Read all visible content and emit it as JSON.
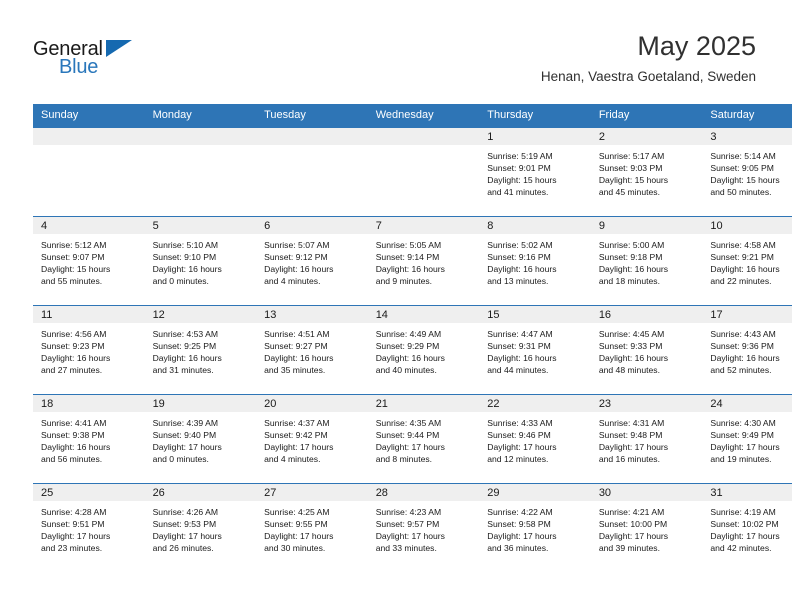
{
  "brand": {
    "name_part1": "General",
    "name_part2": "Blue",
    "flag_icon": "triangle-flag-icon",
    "accent_color": "#2e75b6",
    "dark_color": "#1a1a1a"
  },
  "header": {
    "title": "May 2025",
    "subtitle": "Henan, Vaestra Goetaland, Sweden"
  },
  "calendar": {
    "weekday_headers": [
      "Sunday",
      "Monday",
      "Tuesday",
      "Wednesday",
      "Thursday",
      "Friday",
      "Saturday"
    ],
    "weeks": [
      [
        {
          "day": "",
          "empty": true,
          "sunrise": "",
          "sunset": "",
          "daylight_line1": "",
          "daylight_line2": ""
        },
        {
          "day": "",
          "empty": true,
          "sunrise": "",
          "sunset": "",
          "daylight_line1": "",
          "daylight_line2": ""
        },
        {
          "day": "",
          "empty": true,
          "sunrise": "",
          "sunset": "",
          "daylight_line1": "",
          "daylight_line2": ""
        },
        {
          "day": "",
          "empty": true,
          "sunrise": "",
          "sunset": "",
          "daylight_line1": "",
          "daylight_line2": ""
        },
        {
          "day": "1",
          "empty": false,
          "sunrise": "Sunrise: 5:19 AM",
          "sunset": "Sunset: 9:01 PM",
          "daylight_line1": "Daylight: 15 hours",
          "daylight_line2": "and 41 minutes."
        },
        {
          "day": "2",
          "empty": false,
          "sunrise": "Sunrise: 5:17 AM",
          "sunset": "Sunset: 9:03 PM",
          "daylight_line1": "Daylight: 15 hours",
          "daylight_line2": "and 45 minutes."
        },
        {
          "day": "3",
          "empty": false,
          "sunrise": "Sunrise: 5:14 AM",
          "sunset": "Sunset: 9:05 PM",
          "daylight_line1": "Daylight: 15 hours",
          "daylight_line2": "and 50 minutes."
        }
      ],
      [
        {
          "day": "4",
          "empty": false,
          "sunrise": "Sunrise: 5:12 AM",
          "sunset": "Sunset: 9:07 PM",
          "daylight_line1": "Daylight: 15 hours",
          "daylight_line2": "and 55 minutes."
        },
        {
          "day": "5",
          "empty": false,
          "sunrise": "Sunrise: 5:10 AM",
          "sunset": "Sunset: 9:10 PM",
          "daylight_line1": "Daylight: 16 hours",
          "daylight_line2": "and 0 minutes."
        },
        {
          "day": "6",
          "empty": false,
          "sunrise": "Sunrise: 5:07 AM",
          "sunset": "Sunset: 9:12 PM",
          "daylight_line1": "Daylight: 16 hours",
          "daylight_line2": "and 4 minutes."
        },
        {
          "day": "7",
          "empty": false,
          "sunrise": "Sunrise: 5:05 AM",
          "sunset": "Sunset: 9:14 PM",
          "daylight_line1": "Daylight: 16 hours",
          "daylight_line2": "and 9 minutes."
        },
        {
          "day": "8",
          "empty": false,
          "sunrise": "Sunrise: 5:02 AM",
          "sunset": "Sunset: 9:16 PM",
          "daylight_line1": "Daylight: 16 hours",
          "daylight_line2": "and 13 minutes."
        },
        {
          "day": "9",
          "empty": false,
          "sunrise": "Sunrise: 5:00 AM",
          "sunset": "Sunset: 9:18 PM",
          "daylight_line1": "Daylight: 16 hours",
          "daylight_line2": "and 18 minutes."
        },
        {
          "day": "10",
          "empty": false,
          "sunrise": "Sunrise: 4:58 AM",
          "sunset": "Sunset: 9:21 PM",
          "daylight_line1": "Daylight: 16 hours",
          "daylight_line2": "and 22 minutes."
        }
      ],
      [
        {
          "day": "11",
          "empty": false,
          "sunrise": "Sunrise: 4:56 AM",
          "sunset": "Sunset: 9:23 PM",
          "daylight_line1": "Daylight: 16 hours",
          "daylight_line2": "and 27 minutes."
        },
        {
          "day": "12",
          "empty": false,
          "sunrise": "Sunrise: 4:53 AM",
          "sunset": "Sunset: 9:25 PM",
          "daylight_line1": "Daylight: 16 hours",
          "daylight_line2": "and 31 minutes."
        },
        {
          "day": "13",
          "empty": false,
          "sunrise": "Sunrise: 4:51 AM",
          "sunset": "Sunset: 9:27 PM",
          "daylight_line1": "Daylight: 16 hours",
          "daylight_line2": "and 35 minutes."
        },
        {
          "day": "14",
          "empty": false,
          "sunrise": "Sunrise: 4:49 AM",
          "sunset": "Sunset: 9:29 PM",
          "daylight_line1": "Daylight: 16 hours",
          "daylight_line2": "and 40 minutes."
        },
        {
          "day": "15",
          "empty": false,
          "sunrise": "Sunrise: 4:47 AM",
          "sunset": "Sunset: 9:31 PM",
          "daylight_line1": "Daylight: 16 hours",
          "daylight_line2": "and 44 minutes."
        },
        {
          "day": "16",
          "empty": false,
          "sunrise": "Sunrise: 4:45 AM",
          "sunset": "Sunset: 9:33 PM",
          "daylight_line1": "Daylight: 16 hours",
          "daylight_line2": "and 48 minutes."
        },
        {
          "day": "17",
          "empty": false,
          "sunrise": "Sunrise: 4:43 AM",
          "sunset": "Sunset: 9:36 PM",
          "daylight_line1": "Daylight: 16 hours",
          "daylight_line2": "and 52 minutes."
        }
      ],
      [
        {
          "day": "18",
          "empty": false,
          "sunrise": "Sunrise: 4:41 AM",
          "sunset": "Sunset: 9:38 PM",
          "daylight_line1": "Daylight: 16 hours",
          "daylight_line2": "and 56 minutes."
        },
        {
          "day": "19",
          "empty": false,
          "sunrise": "Sunrise: 4:39 AM",
          "sunset": "Sunset: 9:40 PM",
          "daylight_line1": "Daylight: 17 hours",
          "daylight_line2": "and 0 minutes."
        },
        {
          "day": "20",
          "empty": false,
          "sunrise": "Sunrise: 4:37 AM",
          "sunset": "Sunset: 9:42 PM",
          "daylight_line1": "Daylight: 17 hours",
          "daylight_line2": "and 4 minutes."
        },
        {
          "day": "21",
          "empty": false,
          "sunrise": "Sunrise: 4:35 AM",
          "sunset": "Sunset: 9:44 PM",
          "daylight_line1": "Daylight: 17 hours",
          "daylight_line2": "and 8 minutes."
        },
        {
          "day": "22",
          "empty": false,
          "sunrise": "Sunrise: 4:33 AM",
          "sunset": "Sunset: 9:46 PM",
          "daylight_line1": "Daylight: 17 hours",
          "daylight_line2": "and 12 minutes."
        },
        {
          "day": "23",
          "empty": false,
          "sunrise": "Sunrise: 4:31 AM",
          "sunset": "Sunset: 9:48 PM",
          "daylight_line1": "Daylight: 17 hours",
          "daylight_line2": "and 16 minutes."
        },
        {
          "day": "24",
          "empty": false,
          "sunrise": "Sunrise: 4:30 AM",
          "sunset": "Sunset: 9:49 PM",
          "daylight_line1": "Daylight: 17 hours",
          "daylight_line2": "and 19 minutes."
        }
      ],
      [
        {
          "day": "25",
          "empty": false,
          "sunrise": "Sunrise: 4:28 AM",
          "sunset": "Sunset: 9:51 PM",
          "daylight_line1": "Daylight: 17 hours",
          "daylight_line2": "and 23 minutes."
        },
        {
          "day": "26",
          "empty": false,
          "sunrise": "Sunrise: 4:26 AM",
          "sunset": "Sunset: 9:53 PM",
          "daylight_line1": "Daylight: 17 hours",
          "daylight_line2": "and 26 minutes."
        },
        {
          "day": "27",
          "empty": false,
          "sunrise": "Sunrise: 4:25 AM",
          "sunset": "Sunset: 9:55 PM",
          "daylight_line1": "Daylight: 17 hours",
          "daylight_line2": "and 30 minutes."
        },
        {
          "day": "28",
          "empty": false,
          "sunrise": "Sunrise: 4:23 AM",
          "sunset": "Sunset: 9:57 PM",
          "daylight_line1": "Daylight: 17 hours",
          "daylight_line2": "and 33 minutes."
        },
        {
          "day": "29",
          "empty": false,
          "sunrise": "Sunrise: 4:22 AM",
          "sunset": "Sunset: 9:58 PM",
          "daylight_line1": "Daylight: 17 hours",
          "daylight_line2": "and 36 minutes."
        },
        {
          "day": "30",
          "empty": false,
          "sunrise": "Sunrise: 4:21 AM",
          "sunset": "Sunset: 10:00 PM",
          "daylight_line1": "Daylight: 17 hours",
          "daylight_line2": "and 39 minutes."
        },
        {
          "day": "31",
          "empty": false,
          "sunrise": "Sunrise: 4:19 AM",
          "sunset": "Sunset: 10:02 PM",
          "daylight_line1": "Daylight: 17 hours",
          "daylight_line2": "and 42 minutes."
        }
      ]
    ]
  }
}
